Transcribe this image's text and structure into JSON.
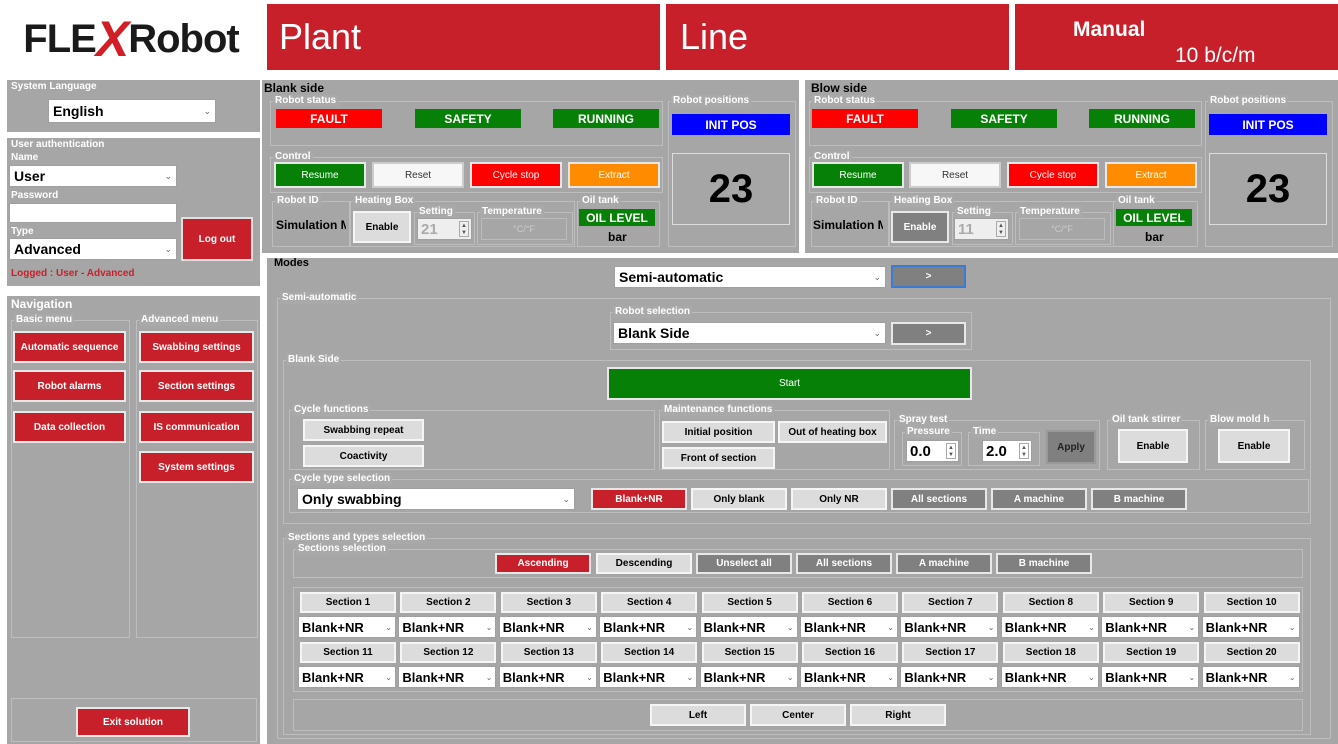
{
  "logo": {
    "text_a": "FLE",
    "text_x": "X",
    "text_b": "Robot"
  },
  "header": {
    "plant": "Plant",
    "line": "Line",
    "mode": "Manual",
    "rate": "10 b/c/m"
  },
  "colors": {
    "brand_red": "#c8202a",
    "panel_gray": "#a6a6a6",
    "status_green": "#078007",
    "status_blue": "#0000ff",
    "extract_orange": "#ff8c00"
  },
  "language": {
    "title": "System Language",
    "value": "English"
  },
  "auth": {
    "title": "User authentication",
    "name_label": "Name",
    "name_value": "User",
    "password_label": "Password",
    "password_value": "",
    "type_label": "Type",
    "type_value": "Advanced",
    "logout": "Log out",
    "logged": "Logged : User - Advanced"
  },
  "nav": {
    "title": "Navigation",
    "basic_title": "Basic menu",
    "advanced_title": "Advanced menu",
    "basic": [
      "Automatic sequence",
      "Robot alarms",
      "Data collection"
    ],
    "advanced": [
      "Swabbing settings",
      "Section settings",
      "IS communication",
      "System settings"
    ],
    "exit": "Exit solution"
  },
  "blank": {
    "title": "Blank side",
    "status_title": "Robot status",
    "fault": "FAULT",
    "safety": "SAFETY",
    "running": "RUNNING",
    "control_title": "Control",
    "resume": "Resume",
    "reset": "Reset",
    "cycle_stop": "Cycle stop",
    "extract": "Extract",
    "positions_title": "Robot positions",
    "init_pos": "INIT POS",
    "count": "23",
    "robot_id_title": "Robot ID",
    "robot_id": "Simulation M",
    "heating_title": "Heating Box",
    "enable": "Enable",
    "setting_title": "Setting",
    "setting_value": "21",
    "temp_title": "Temperature",
    "temp_value": "°C/°F",
    "oil_title": "Oil tank",
    "oil_level": "OIL LEVEL",
    "bar": "bar"
  },
  "blow": {
    "title": "Blow side",
    "status_title": "Robot status",
    "fault": "FAULT",
    "safety": "SAFETY",
    "running": "RUNNING",
    "control_title": "Control",
    "resume": "Resume",
    "reset": "Reset",
    "cycle_stop": "Cycle stop",
    "extract": "Extract",
    "positions_title": "Robot positions",
    "init_pos": "INIT POS",
    "count": "23",
    "robot_id_title": "Robot ID",
    "robot_id": "Simulation M",
    "heating_title": "Heating Box",
    "enable": "Enable",
    "setting_title": "Setting",
    "setting_value": "11",
    "temp_title": "Temperature",
    "temp_value": "°C/°F",
    "oil_title": "Oil tank",
    "oil_level": "OIL LEVEL",
    "bar": "bar"
  },
  "modes": {
    "title": "Modes",
    "mode_value": "Semi-automatic",
    "go": ">"
  },
  "semi": {
    "title": "Semi-automatic",
    "robot_sel_title": "Robot selection",
    "robot_sel_value": "Blank Side",
    "go": ">",
    "blank_side_title": "Blank Side",
    "start": "Start",
    "cycle_title": "Cycle functions",
    "swabbing_repeat": "Swabbing repeat",
    "coactivity": "Coactivity",
    "maint_title": "Maintenance functions",
    "initial_position": "Initial position",
    "out_heating": "Out of heating box",
    "front_section": "Front of section",
    "spray_title": "Spray test",
    "pressure_title": "Pressure",
    "pressure_value": "0.0",
    "time_title": "Time",
    "time_value": "2.0",
    "apply": "Apply",
    "oil_stirrer_title": "Oil tank stirrer",
    "oil_stirrer_btn": "Enable",
    "blow_mold_title": "Blow mold h",
    "blow_mold_btn": "Enable",
    "cycle_type_title": "Cycle type selection",
    "cycle_type_value": "Only swabbing",
    "cycle_types": [
      "Blank+NR",
      "Only blank",
      "Only NR",
      "All sections",
      "A machine",
      "B machine"
    ]
  },
  "sections": {
    "title": "Sections and types selection",
    "sel_title": "Sections selection",
    "buttons": [
      "Ascending",
      "Descending",
      "Unselect all",
      "All sections",
      "A machine",
      "B machine"
    ],
    "names_row1": [
      "Section 1",
      "Section 2",
      "Section 3",
      "Section 4",
      "Section 5",
      "Section 6",
      "Section 7",
      "Section 8",
      "Section 9",
      "Section 10"
    ],
    "names_row2": [
      "Section 11",
      "Section 12",
      "Section 13",
      "Section 14",
      "Section 15",
      "Section 16",
      "Section 17",
      "Section 18",
      "Section 19",
      "Section 20"
    ],
    "value": "Blank+NR",
    "bottom": [
      "Left",
      "Center",
      "Right"
    ]
  }
}
